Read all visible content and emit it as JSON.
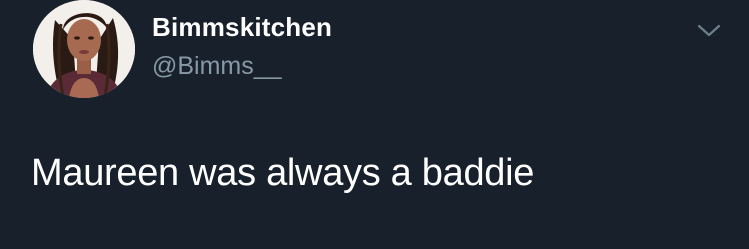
{
  "tweet": {
    "author": {
      "display_name": "Bimmskitchen",
      "handle": "@Bimms__",
      "avatar": "profile-photo"
    },
    "text": "Maureen was always a baddie",
    "menu_icon": "chevron-down-icon"
  },
  "colors": {
    "background": "#17202b",
    "primary_text": "#ffffff",
    "secondary_text": "#8899a6"
  }
}
